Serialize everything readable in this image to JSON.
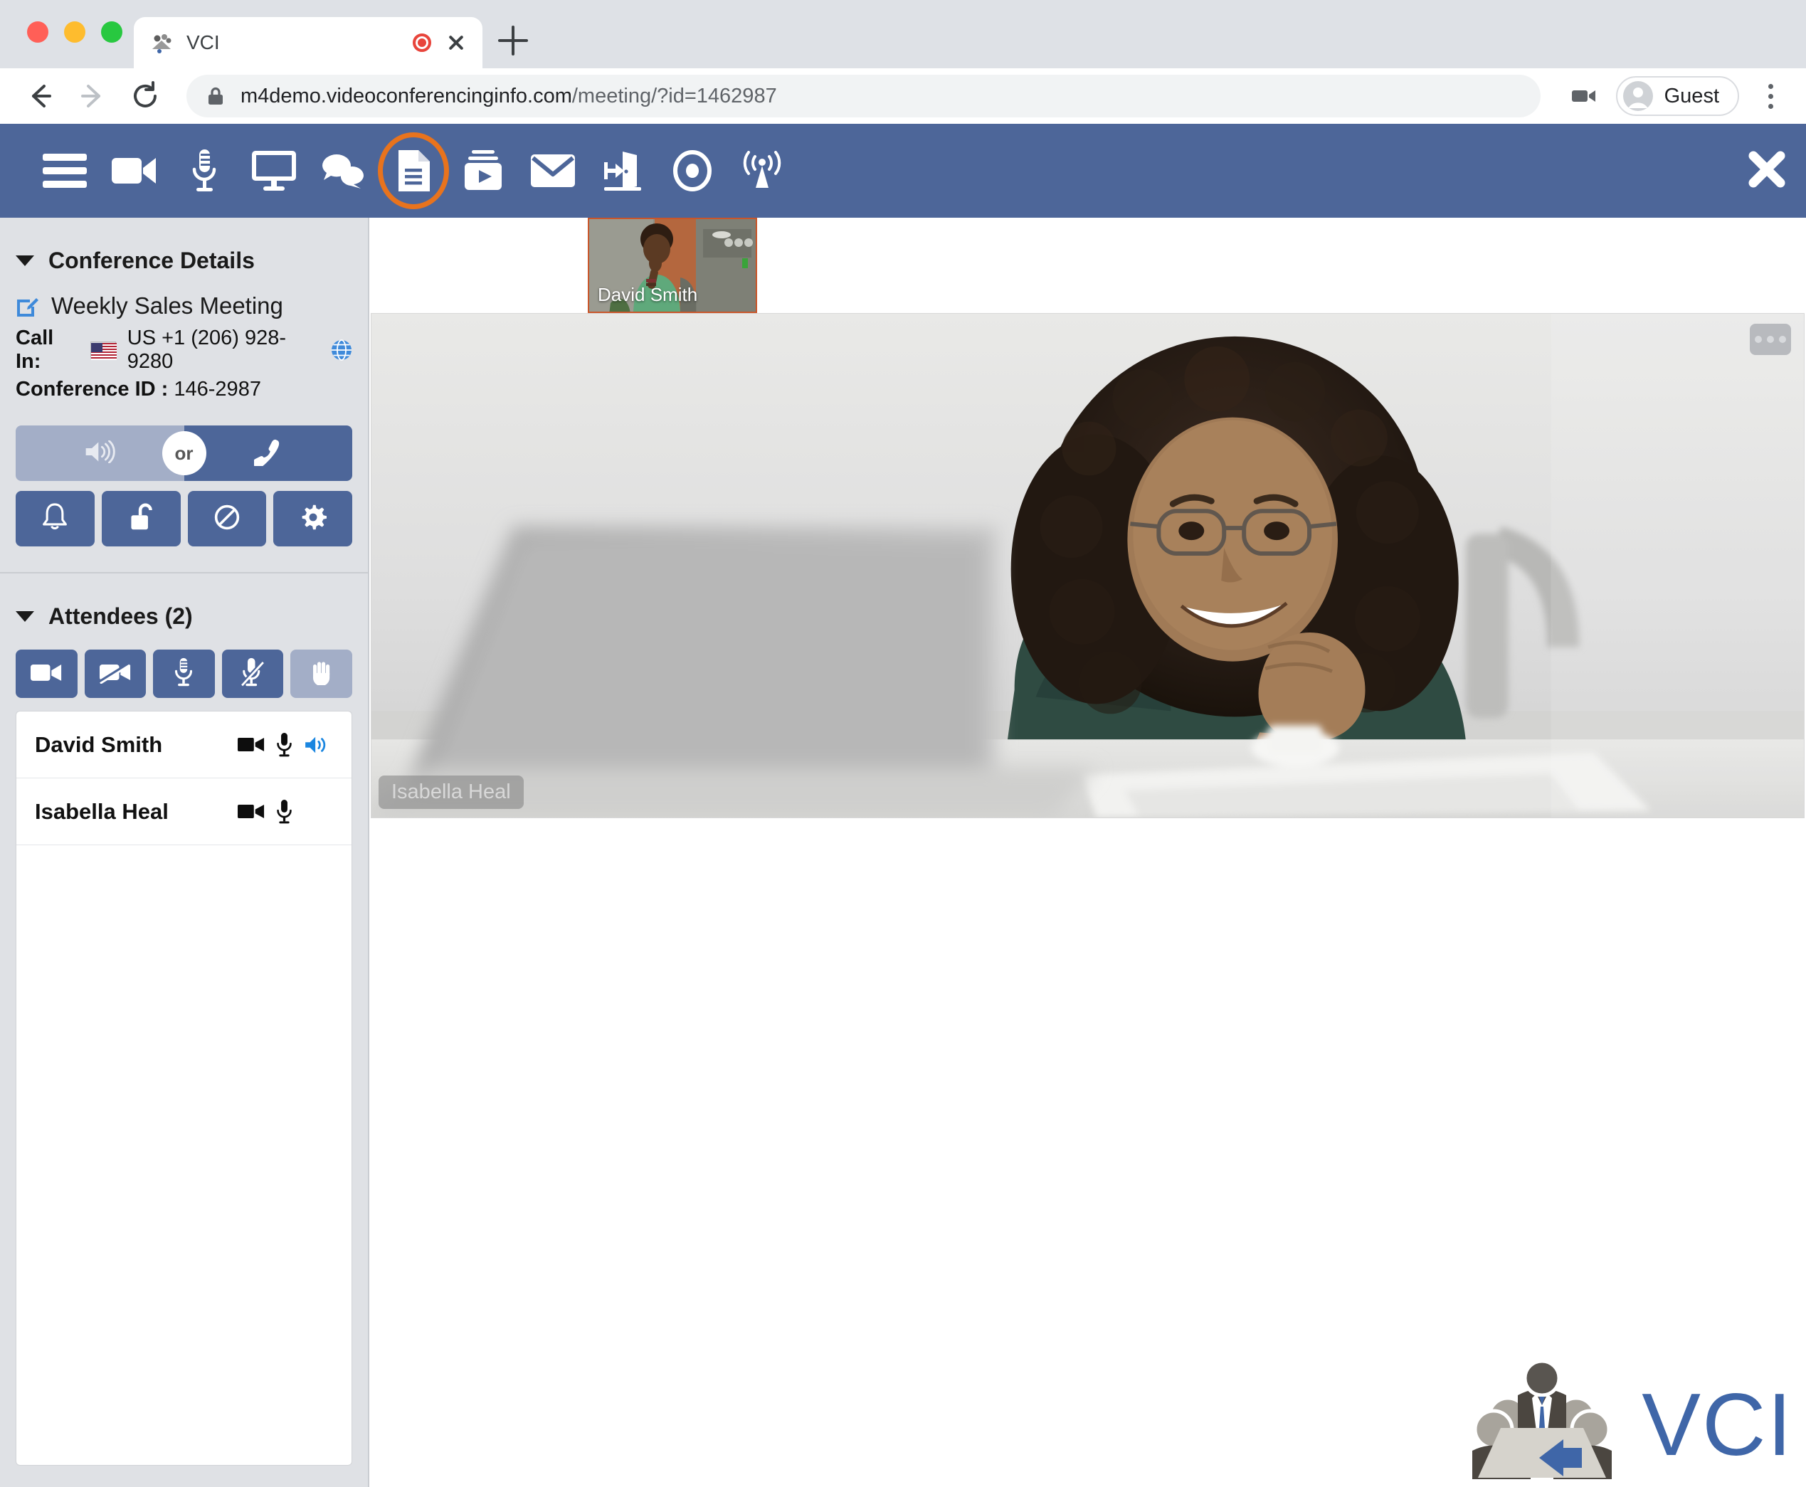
{
  "browser": {
    "tab": {
      "title": "VCI",
      "favicon_icon": "vci-conference-favicon",
      "recording_icon": "recording-dot-icon",
      "close_icon": "close-icon"
    },
    "new_tab_icon": "plus-icon",
    "back_icon": "back-arrow-icon",
    "forward_icon": "forward-arrow-icon",
    "reload_icon": "reload-icon",
    "lock_icon": "lock-icon",
    "url_main": "m4demo.videoconferencinginfo.com",
    "url_path": "/meeting/?id=1462987",
    "camera_icon": "camera-permission-icon",
    "profile": {
      "name": "Guest",
      "avatar_icon": "person-avatar-icon"
    },
    "menu_icon": "kebab-menu-icon"
  },
  "app_toolbar": {
    "accent_highlight_color": "#e8731d",
    "background_color": "#4d6699",
    "items": [
      {
        "name": "menu",
        "icon": "hamburger-menu-icon",
        "highlighted": false
      },
      {
        "name": "video",
        "icon": "video-camera-icon",
        "highlighted": false
      },
      {
        "name": "microphone",
        "icon": "microphone-icon",
        "highlighted": false
      },
      {
        "name": "share-screen",
        "icon": "monitor-screen-icon",
        "highlighted": false
      },
      {
        "name": "chat",
        "icon": "chat-bubbles-icon",
        "highlighted": false
      },
      {
        "name": "documents",
        "icon": "document-file-icon",
        "highlighted": true
      },
      {
        "name": "media-player",
        "icon": "media-play-box-icon",
        "highlighted": false
      },
      {
        "name": "email",
        "icon": "envelope-icon",
        "highlighted": false
      },
      {
        "name": "enter-room",
        "icon": "enter-door-icon",
        "highlighted": false
      },
      {
        "name": "record",
        "icon": "record-circle-icon",
        "highlighted": false
      },
      {
        "name": "broadcast",
        "icon": "broadcast-antenna-icon",
        "highlighted": false
      }
    ],
    "close_icon": "close-x-icon"
  },
  "sidebar": {
    "conference_details": {
      "section_title": "Conference Details",
      "caret_icon": "caret-down-icon",
      "edit_icon": "edit-pencil-icon",
      "meeting_name": "Weekly Sales Meeting",
      "call_in_label": "Call In:",
      "flag_icon": "us-flag-icon",
      "call_in_number": "US +1 (206) 928-9280",
      "globe_icon": "globe-icon",
      "conference_id_label": "Conference ID :",
      "conference_id_value": "146-2987",
      "audio_switch": {
        "computer_audio_icon": "speaker-wave-icon",
        "or_label": "or",
        "phone_audio_icon": "phone-handset-icon",
        "active_side": "phone"
      },
      "buttons": [
        {
          "name": "notifications",
          "icon": "bell-icon"
        },
        {
          "name": "lock-meeting",
          "icon": "unlocked-padlock-icon"
        },
        {
          "name": "block",
          "icon": "no-entry-icon"
        },
        {
          "name": "settings",
          "icon": "gear-icon"
        }
      ]
    },
    "attendees": {
      "section_title": "Attendees (2)",
      "caret_icon": "caret-down-icon",
      "count": 2,
      "tools": [
        {
          "name": "start-all-video",
          "icon": "video-camera-icon",
          "state": "active"
        },
        {
          "name": "stop-all-video",
          "icon": "video-camera-off-icon",
          "state": "active"
        },
        {
          "name": "unmute-all",
          "icon": "microphone-icon",
          "state": "active"
        },
        {
          "name": "mute-all",
          "icon": "microphone-off-icon",
          "state": "active"
        },
        {
          "name": "raise-hand",
          "icon": "raised-hand-icon",
          "state": "inactive"
        }
      ],
      "list": [
        {
          "name": "David Smith",
          "video_icon": "video-camera-icon",
          "mic_icon": "microphone-icon",
          "speaker_icon": "speaker-wave-icon",
          "speaker_active": true
        },
        {
          "name": "Isabella Heal",
          "video_icon": "video-camera-icon",
          "mic_icon": "microphone-icon",
          "speaker_icon": null,
          "speaker_active": false
        }
      ]
    }
  },
  "stage": {
    "thumbnail": {
      "label": "David Smith",
      "border_color": "#c9562a"
    },
    "main_video": {
      "label": "Isabella Heal",
      "more_icon": "more-options-icon"
    },
    "watermark": {
      "text": "VCI",
      "logo_icon": "vci-conference-table-logo",
      "color": "#3f66a8"
    }
  }
}
